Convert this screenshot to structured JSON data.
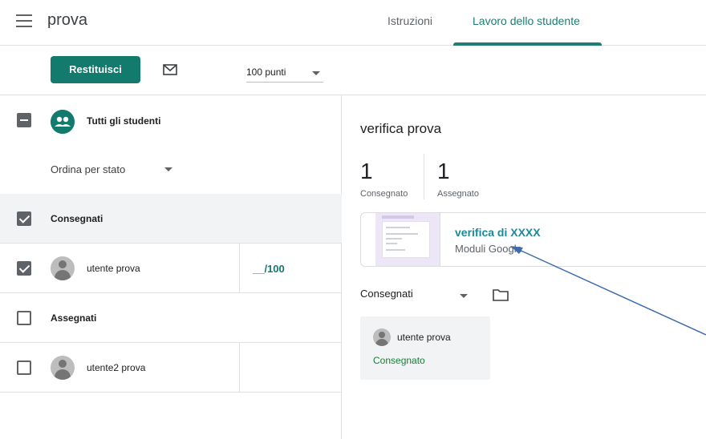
{
  "header": {
    "title": "prova",
    "tabs": [
      {
        "label": "Istruzioni"
      },
      {
        "label": "Lavoro dello studente"
      }
    ]
  },
  "toolbar": {
    "return_label": "Restituisci",
    "points_value": "100 punti"
  },
  "students": {
    "all_label": "Tutti gli studenti",
    "sort_label": "Ordina per stato",
    "groups": [
      {
        "label": "Consegnati"
      },
      {
        "label": "Assegnati"
      }
    ],
    "rows": [
      {
        "name": "utente prova",
        "grade": "__/100"
      },
      {
        "name": "utente2 prova",
        "grade": ""
      }
    ]
  },
  "assignment": {
    "title": "verifica prova",
    "stats": [
      {
        "value": "1",
        "label": "Consegnato"
      },
      {
        "value": "1",
        "label": "Assegnato"
      }
    ],
    "attachment": {
      "title": "verifica di XXXX",
      "subtitle": "Moduli Google"
    },
    "filter_label": "Consegnati",
    "card": {
      "name": "utente prova",
      "status": "Consegnato"
    }
  },
  "colors": {
    "accent": "#137a6e",
    "link": "#1a8a9b",
    "status_green": "#188038",
    "annotation_arrow": "#3c6bb0"
  }
}
